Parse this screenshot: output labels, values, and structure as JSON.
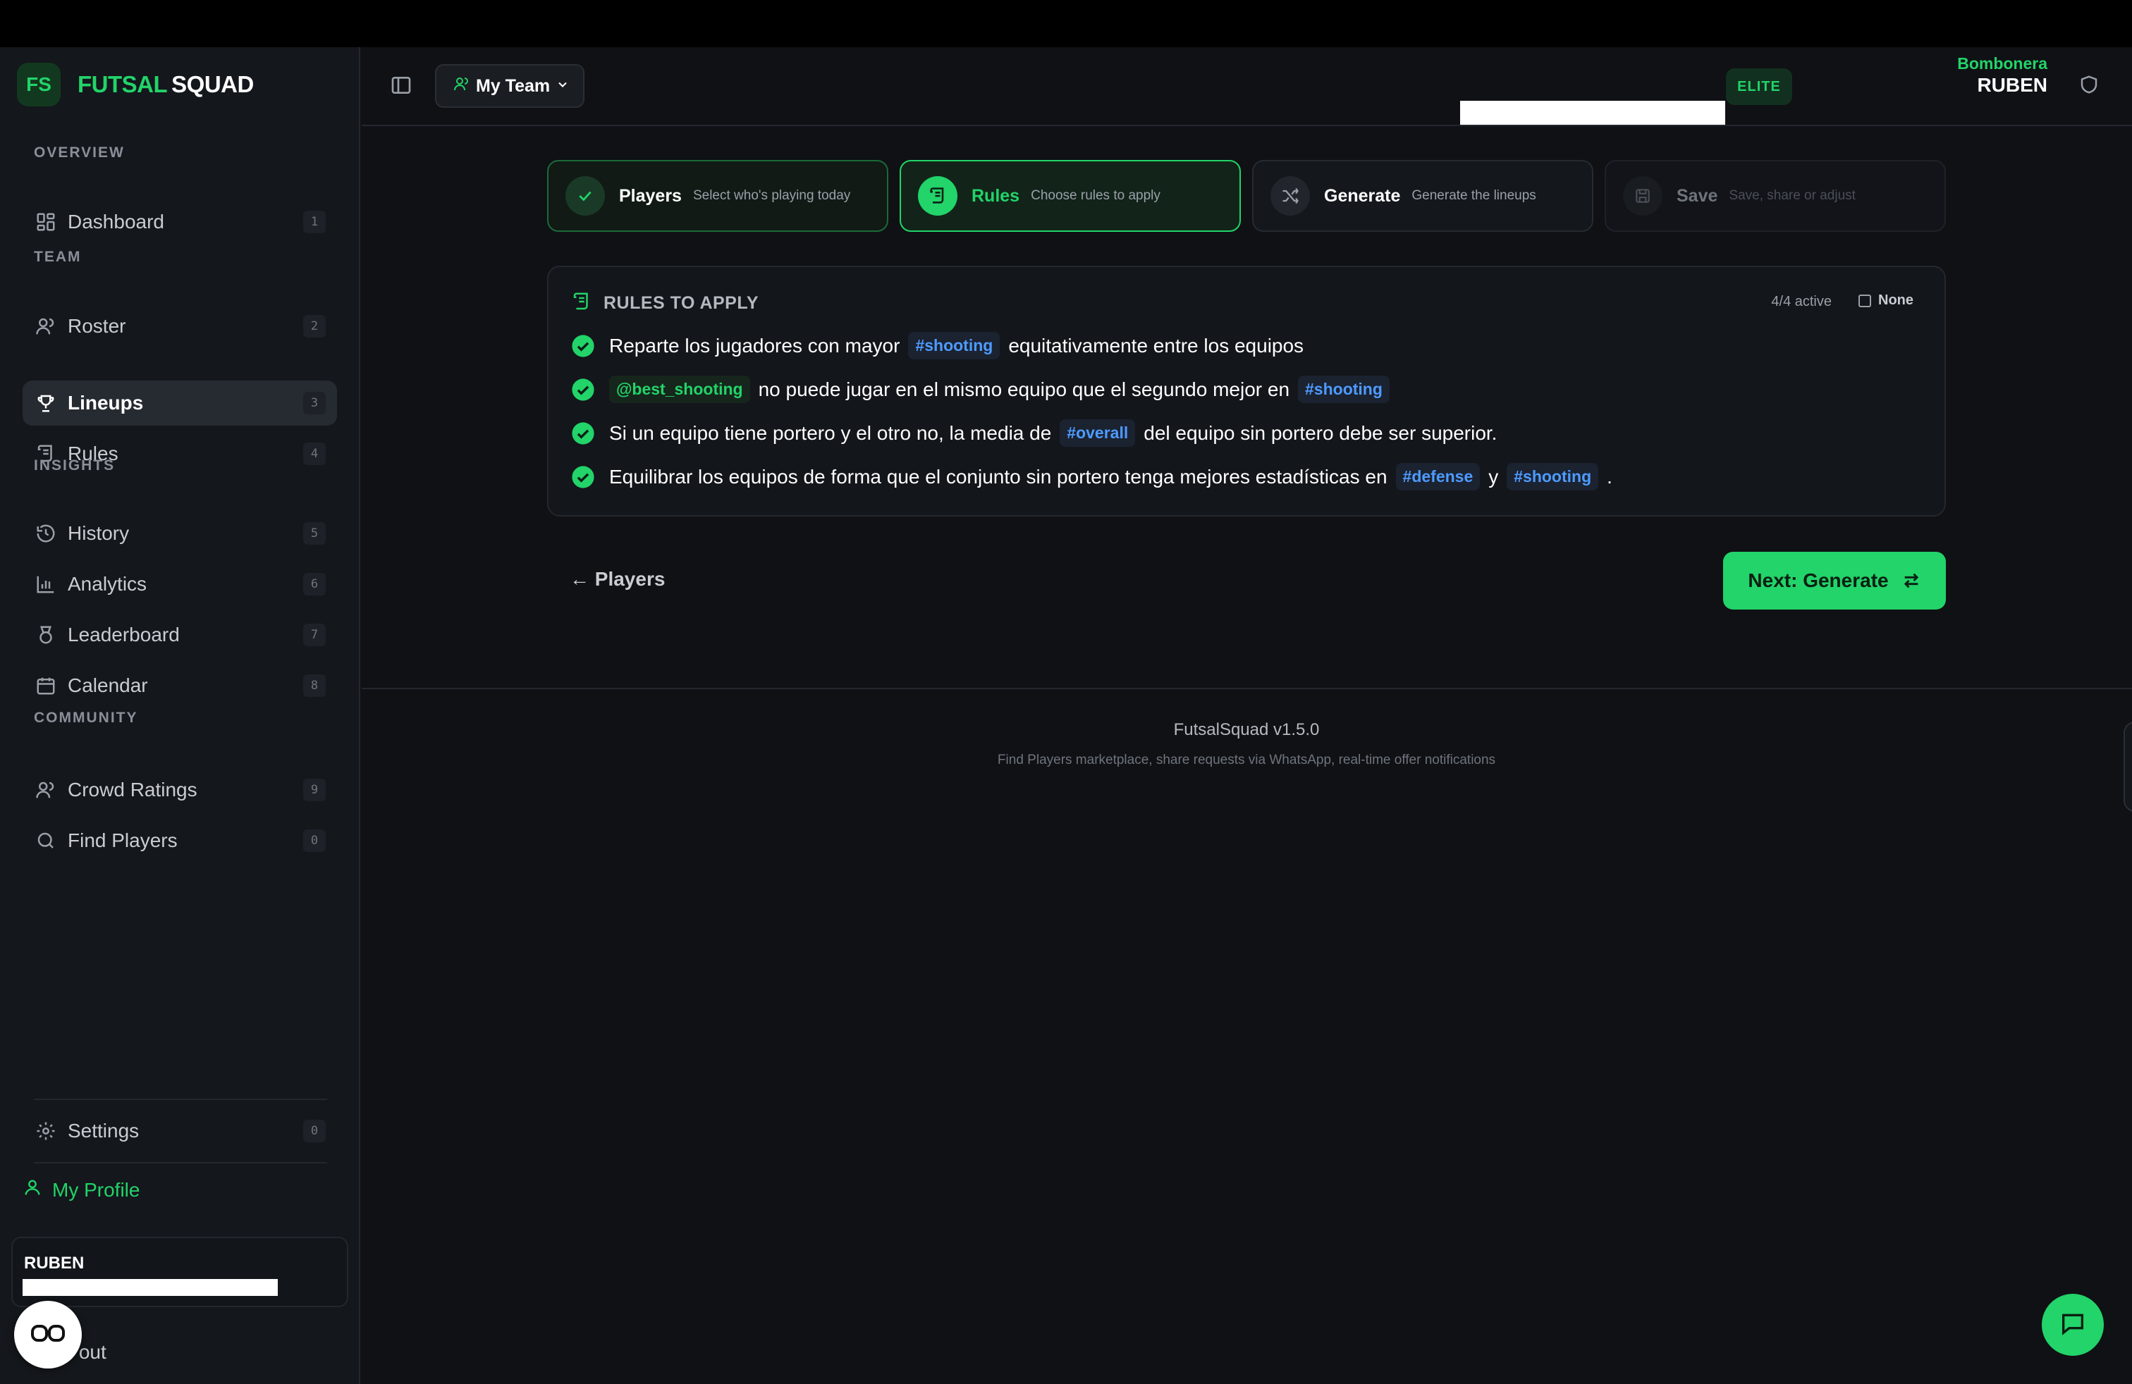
{
  "brand": {
    "logo": "FS",
    "name_a": "FUTSAL",
    "name_b": "SQUAD"
  },
  "sidebar": {
    "sections": {
      "overview": "OVERVIEW",
      "team": "TEAM",
      "insights": "INSIGHTS",
      "community": "COMMUNITY"
    },
    "items": [
      {
        "label": "Dashboard",
        "key": "1",
        "icon": "dashboard-icon"
      },
      {
        "label": "Roster",
        "key": "2",
        "icon": "users-icon"
      },
      {
        "label": "Lineups",
        "key": "3",
        "icon": "trophy-icon",
        "active": true
      },
      {
        "label": "Rules",
        "key": "4",
        "icon": "scroll-icon"
      },
      {
        "label": "History",
        "key": "5",
        "icon": "history-icon"
      },
      {
        "label": "Analytics",
        "key": "6",
        "icon": "bar-chart-icon"
      },
      {
        "label": "Leaderboard",
        "key": "7",
        "icon": "medal-icon"
      },
      {
        "label": "Calendar",
        "key": "8",
        "icon": "calendar-icon"
      },
      {
        "label": "Crowd Ratings",
        "key": "9",
        "icon": "users-icon"
      },
      {
        "label": "Find Players",
        "key": "0",
        "icon": "search-icon"
      }
    ],
    "settings": {
      "label": "Settings",
      "key": "0"
    },
    "my_profile": "My Profile",
    "user_name": "RUBEN",
    "sign_out": "Sign out"
  },
  "header": {
    "team_button": "My Team",
    "plan_badge": "ELITE",
    "venue": "Bombonera",
    "user": "RUBEN"
  },
  "steps": [
    {
      "title": "Players",
      "desc": "Select who's playing today",
      "state": "done"
    },
    {
      "title": "Rules",
      "desc": "Choose rules to apply",
      "state": "current"
    },
    {
      "title": "Generate",
      "desc": "Generate the lineups",
      "state": "next"
    },
    {
      "title": "Save",
      "desc": "Save, share or adjust",
      "state": "disabled"
    }
  ],
  "rules_panel": {
    "title": "RULES TO APPLY",
    "active_count": "4/4 active",
    "none_label": "None",
    "rules": [
      {
        "t1": "Reparte los jugadores con mayor",
        "tag1": "#shooting",
        "t2": "equitativamente entre los equipos"
      },
      {
        "user_tag": "@best_shooting",
        "t1": "no puede jugar en el mismo equipo que el segundo mejor en",
        "tag1": "#shooting"
      },
      {
        "t1": "Si un equipo tiene portero y el otro no, la media de",
        "tag1": "#overall",
        "t2": "del equipo sin portero debe ser superior."
      },
      {
        "t1": "Equilibrar los equipos de forma que el conjunto sin portero tenga mejores estadísticas en",
        "tag1": "#defense",
        "t2": "y",
        "tag2": "#shooting",
        "t3": "."
      }
    ]
  },
  "nav": {
    "back": "← Players",
    "next": "Next: Generate"
  },
  "footer": {
    "version": "FutsalSquad v1.5.0",
    "notes": "Find Players marketplace, share requests via WhatsApp, real-time offer notifications"
  },
  "colors": {
    "accent": "#22d469",
    "tag_blue": "#4d9bff",
    "background": "#0f1115"
  }
}
